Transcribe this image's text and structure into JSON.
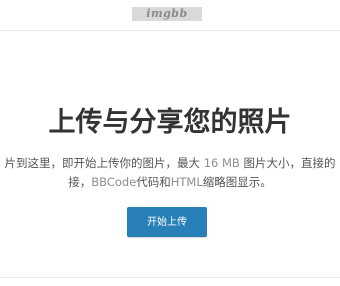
{
  "header": {
    "logo_text": "imgbb"
  },
  "hero": {
    "title": "上传与分享您的照片",
    "description_line1_part1": "片到这里，即开始上传你的图片，最大 ",
    "description_line1_size": "16 MB",
    "description_line1_part2": " 图片大小，直接的",
    "description_line2_part1": "接，",
    "description_line2_bbcode": "BBCode",
    "description_line2_part2": "代码和",
    "description_line2_html": "HTML",
    "description_line2_part3": "缩略图显示。",
    "start_button_label": "开始上传"
  },
  "colors": {
    "button_blue": "#2980b9",
    "title_text": "#333333"
  }
}
